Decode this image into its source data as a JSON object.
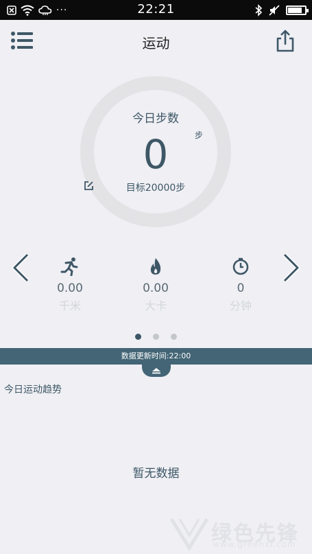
{
  "statusbar": {
    "time": "22:21",
    "more": "···",
    "icons": [
      "notification-close-icon",
      "wifi-icon",
      "cloud-icon",
      "bluetooth-icon",
      "mute-icon",
      "battery-icon"
    ]
  },
  "header": {
    "title": "运动",
    "menu_icon": "list-menu-icon",
    "share_icon": "share-icon"
  },
  "ring": {
    "label": "今日步数",
    "unit": "步",
    "value": "0",
    "goal": "目标20000步",
    "progress_fraction": 0
  },
  "stats": [
    {
      "icon": "running-icon",
      "value": "0.00",
      "unit": "千米"
    },
    {
      "icon": "flame-icon",
      "value": "0.00",
      "unit": "大卡"
    },
    {
      "icon": "timer-icon",
      "value": "0",
      "unit": "分钟"
    }
  ],
  "pager": {
    "count": 3,
    "active": 1
  },
  "update_bar": {
    "text": "数据更新时间:22:00"
  },
  "trend": {
    "title": "今日运动趋势",
    "empty_text": "暂无数据"
  },
  "watermark": {
    "text": "绿色先锋",
    "url": "www.greenxf.com"
  },
  "colors": {
    "primary": "#3e5766",
    "bar": "#436575",
    "background": "#efeff4",
    "ring_track": "#e3e3e6"
  }
}
